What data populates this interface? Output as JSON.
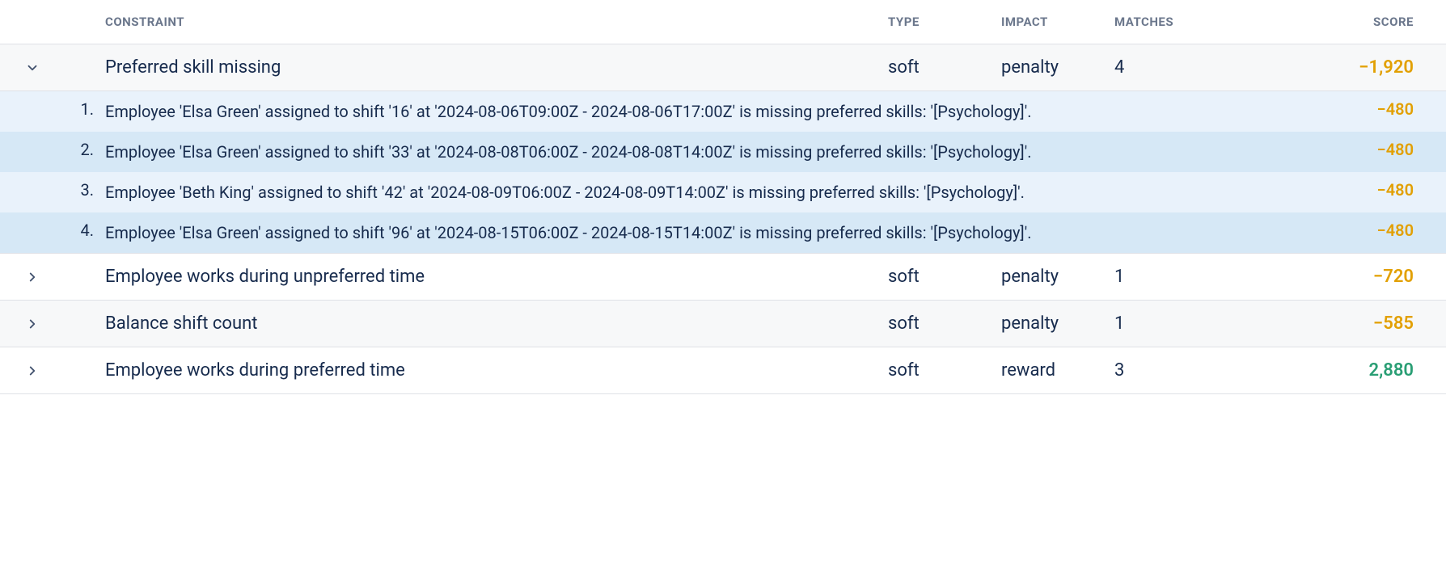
{
  "headers": {
    "constraint": "CONSTRAINT",
    "type": "TYPE",
    "impact": "IMPACT",
    "matches": "MATCHES",
    "score": "SCORE"
  },
  "rows": [
    {
      "expanded": true,
      "alt": true,
      "constraint": "Preferred skill missing",
      "type": "soft",
      "impact": "penalty",
      "matches": "4",
      "score": "−1,920",
      "score_sign": "negative",
      "details": [
        {
          "num": "1.",
          "text": "Employee 'Elsa Green' assigned to shift '16' at '2024-08-06T09:00Z - 2024-08-06T17:00Z' is missing preferred skills: '[Psychology]'.",
          "score": "−480",
          "alt": false
        },
        {
          "num": "2.",
          "text": "Employee 'Elsa Green' assigned to shift '33' at '2024-08-08T06:00Z - 2024-08-08T14:00Z' is missing preferred skills: '[Psychology]'.",
          "score": "−480",
          "alt": true
        },
        {
          "num": "3.",
          "text": "Employee 'Beth King' assigned to shift '42' at '2024-08-09T06:00Z - 2024-08-09T14:00Z' is missing preferred skills: '[Psychology]'.",
          "score": "−480",
          "alt": false
        },
        {
          "num": "4.",
          "text": "Employee 'Elsa Green' assigned to shift '96' at '2024-08-15T06:00Z - 2024-08-15T14:00Z' is missing preferred skills: '[Psychology]'.",
          "score": "−480",
          "alt": true
        }
      ]
    },
    {
      "expanded": false,
      "alt": false,
      "constraint": "Employee works during unpreferred time",
      "type": "soft",
      "impact": "penalty",
      "matches": "1",
      "score": "−720",
      "score_sign": "negative",
      "details": []
    },
    {
      "expanded": false,
      "alt": true,
      "constraint": "Balance shift count",
      "type": "soft",
      "impact": "penalty",
      "matches": "1",
      "score": "−585",
      "score_sign": "negative",
      "details": []
    },
    {
      "expanded": false,
      "alt": false,
      "constraint": "Employee works during preferred time",
      "type": "soft",
      "impact": "reward",
      "matches": "3",
      "score": "2,880",
      "score_sign": "positive",
      "details": []
    }
  ]
}
